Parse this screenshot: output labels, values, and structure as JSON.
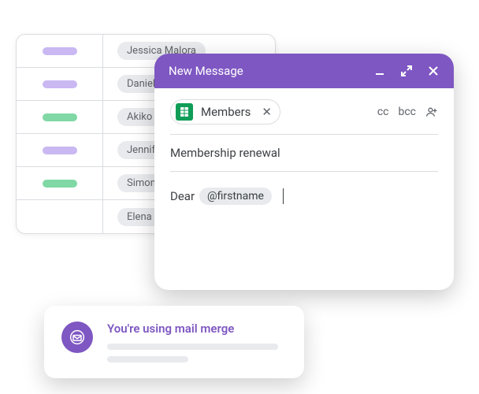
{
  "table": {
    "rows": [
      {
        "color": "purple",
        "name": "Jessica Malora"
      },
      {
        "color": "purple",
        "name": "Daniel Ferr"
      },
      {
        "color": "green",
        "name": "Akiko Naka"
      },
      {
        "color": "purple",
        "name": "Jennifer Ac"
      },
      {
        "color": "green",
        "name": "Simon Balli"
      },
      {
        "color": "",
        "name": "Elena Lee"
      }
    ]
  },
  "compose": {
    "title": "New Message",
    "recipient_chip": "Members",
    "cc": "cc",
    "bcc": "bcc",
    "subject": "Membership renewal",
    "greeting": "Dear",
    "merge_field": "@firstname"
  },
  "toast": {
    "title": "You're using mail merge"
  }
}
